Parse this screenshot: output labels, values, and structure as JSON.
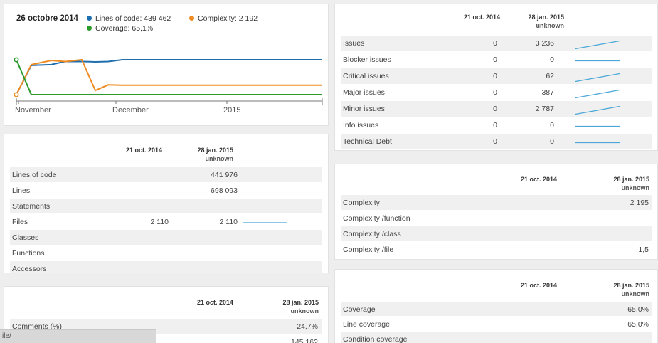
{
  "chart": {
    "date_title": "26 octobre 2014",
    "legend": [
      {
        "label": "Lines of code: 439 462",
        "color": "#1f6fae"
      },
      {
        "label": "Complexity: 2 192",
        "color": "#f08c24"
      },
      {
        "label": "Coverage: 65,1%",
        "color": "#2a9a2a"
      }
    ],
    "x_labels": [
      "November",
      "December",
      "2015"
    ]
  },
  "chart_data": {
    "type": "line",
    "title": "",
    "x_ticks": [
      "November",
      "December",
      "2015"
    ],
    "series": [
      {
        "name": "Lines of code",
        "color": "#1f6fae",
        "values": [
          0.0,
          0.84,
          0.86,
          0.95,
          0.95,
          0.94,
          0.95,
          1.0,
          1.0,
          1.0,
          1.0,
          1.0,
          1.0,
          1.0
        ]
      },
      {
        "name": "Complexity",
        "color": "#f08c24",
        "values": [
          0.0,
          0.86,
          0.98,
          0.95,
          1.0,
          0.12,
          0.28,
          0.27,
          0.27,
          0.27,
          0.27,
          0.27,
          0.27,
          0.27
        ]
      },
      {
        "name": "Coverage",
        "color": "#2a9a2a",
        "values": [
          1.0,
          0.0,
          0.0,
          0.0,
          0.0,
          0.0,
          0.0,
          0.0,
          0.0,
          0.0,
          0.0,
          0.0,
          0.0,
          0.0
        ]
      }
    ],
    "grid": false
  },
  "size_table": {
    "col1": "21 oct. 2014",
    "col2": "28 jan. 2015",
    "col2_sub": "unknown",
    "rows": [
      {
        "name": "Lines of code",
        "v1": "",
        "v2": "441 976",
        "trend": "none"
      },
      {
        "name": "Lines",
        "v1": "",
        "v2": "698 093",
        "trend": "none"
      },
      {
        "name": "Statements",
        "v1": "",
        "v2": "",
        "trend": "none"
      },
      {
        "name": "Files",
        "v1": "2 110",
        "v2": "2 110",
        "trend": "flat"
      },
      {
        "name": "Classes",
        "v1": "",
        "v2": "",
        "trend": "none"
      },
      {
        "name": "Functions",
        "v1": "",
        "v2": "",
        "trend": "none"
      },
      {
        "name": "Accessors",
        "v1": "",
        "v2": "",
        "trend": "none"
      }
    ]
  },
  "comments_table": {
    "col1": "21 oct. 2014",
    "col2": "28 jan. 2015",
    "col2_sub": "unknown",
    "rows": [
      {
        "name": "Comments (%)",
        "v1": "",
        "v2": "24,7%",
        "trend": "none"
      },
      {
        "name": "",
        "v1": "",
        "v2": "145 162",
        "trend": "none"
      }
    ]
  },
  "issues_table": {
    "col1": "21 oct. 2014",
    "col2": "28 jan. 2015",
    "col2_sub": "unknown",
    "rows": [
      {
        "name": "Issues",
        "v1": "0",
        "v2": "3 236",
        "trend": "up"
      },
      {
        "name": "Blocker issues",
        "v1": "0",
        "v2": "0",
        "trend": "flat"
      },
      {
        "name": "Critical issues",
        "v1": "0",
        "v2": "62",
        "trend": "up"
      },
      {
        "name": "Major issues",
        "v1": "0",
        "v2": "387",
        "trend": "up"
      },
      {
        "name": "Minor issues",
        "v1": "0",
        "v2": "2 787",
        "trend": "up"
      },
      {
        "name": "Info issues",
        "v1": "0",
        "v2": "0",
        "trend": "flat"
      },
      {
        "name": "Technical Debt",
        "v1": "0",
        "v2": "0",
        "trend": "flat"
      }
    ]
  },
  "complexity_table": {
    "col1": "21 oct. 2014",
    "col2": "28 jan. 2015",
    "col2_sub": "unknown",
    "rows": [
      {
        "name": "Complexity",
        "v1": "",
        "v2": "2 195",
        "trend": "none"
      },
      {
        "name": "Complexity /function",
        "v1": "",
        "v2": "",
        "trend": "none"
      },
      {
        "name": "Complexity /class",
        "v1": "",
        "v2": "",
        "trend": "none"
      },
      {
        "name": "Complexity /file",
        "v1": "",
        "v2": "1,5",
        "trend": "none"
      }
    ]
  },
  "coverage_table": {
    "col1": "21 oct. 2014",
    "col2": "28 jan. 2015",
    "col2_sub": "unknown",
    "rows": [
      {
        "name": "Coverage",
        "v1": "",
        "v2": "65,0%",
        "trend": "none"
      },
      {
        "name": "Line coverage",
        "v1": "",
        "v2": "65,0%",
        "trend": "none"
      },
      {
        "name": "Condition coverage",
        "v1": "",
        "v2": "",
        "trend": "none"
      }
    ]
  },
  "status_bar": {
    "url": "ile/"
  },
  "colors": {
    "sparkline": "#4aa8d8",
    "row_shade": "#f0f0f0"
  }
}
